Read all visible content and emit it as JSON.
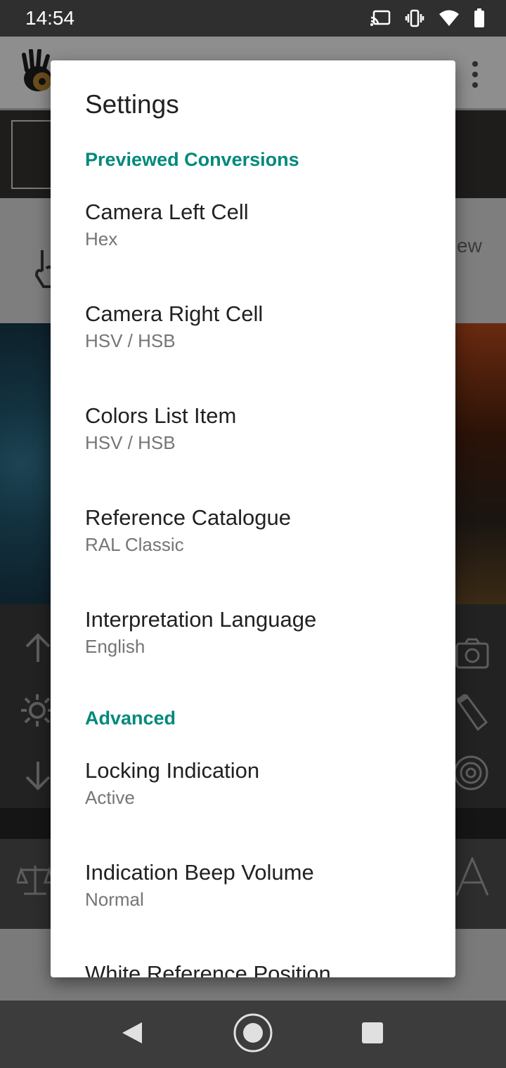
{
  "status_bar": {
    "time": "14:54",
    "icons": [
      "cast-icon",
      "vibrate-icon",
      "wifi-icon",
      "battery-icon"
    ]
  },
  "background_app": {
    "partial_label": "ew",
    "icons": [
      "app-logo-icon",
      "more-vert-icon",
      "hand-touch-icon",
      "arrow-up-icon",
      "brightness-icon",
      "arrow-down-icon",
      "camera-switch-icon",
      "flashlight-icon",
      "target-icon",
      "balance-scale-icon",
      "letter-a-icon"
    ]
  },
  "dialog": {
    "title": "Settings",
    "sections": [
      {
        "header": "Previewed Conversions",
        "items": [
          {
            "title": "Camera Left Cell",
            "summary": "Hex"
          },
          {
            "title": "Camera Right Cell",
            "summary": "HSV / HSB"
          },
          {
            "title": "Colors List Item",
            "summary": "HSV / HSB"
          },
          {
            "title": "Reference Catalogue",
            "summary": "RAL Classic"
          },
          {
            "title": "Interpretation Language",
            "summary": "English"
          }
        ]
      },
      {
        "header": "Advanced",
        "items": [
          {
            "title": "Locking Indication",
            "summary": "Active"
          },
          {
            "title": "Indication Beep Volume",
            "summary": "Normal"
          },
          {
            "title": "White Reference Position",
            "summary": ""
          }
        ]
      }
    ]
  },
  "nav_bar": {
    "buttons": [
      "back-icon",
      "home-icon",
      "recents-icon"
    ]
  },
  "colors": {
    "accent": "#00897b",
    "title_text": "#212121",
    "summary_text": "#757575",
    "dialog_bg": "#ffffff"
  }
}
